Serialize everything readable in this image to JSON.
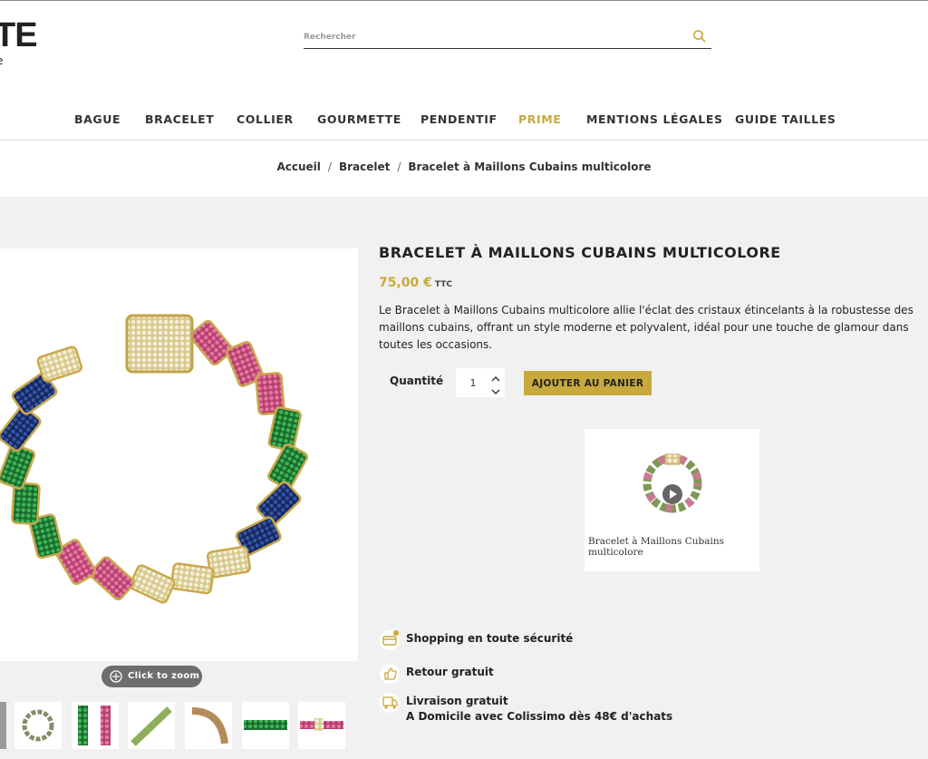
{
  "header": {
    "logo_text": "TE",
    "logo_sub": "e",
    "search_placeholder": "Rechercher"
  },
  "nav": {
    "items": [
      "BAGUE",
      "BRACELET",
      "COLLIER",
      "GOURMETTE",
      "PENDENTIF",
      "PRIME",
      "MENTIONS LÉGALES",
      "GUIDE TAILLES"
    ],
    "active_accent": "PRIME"
  },
  "breadcrumb": [
    "Accueil",
    "Bracelet",
    "Bracelet à Maillons Cubains multicolore"
  ],
  "product": {
    "title": "BRACELET À MAILLONS CUBAINS MULTICOLORE",
    "price": "75,00 €",
    "price_suffix": "TTC",
    "description_lines": [
      "Le Bracelet à Maillons Cubains multicolore allie l'éclat des cristaux étincelants à la robustesse des",
      "maillons cubains, offrant un style moderne et polyvalent, idéal pour une touche de glamour dans",
      "toutes les occasions."
    ],
    "quantity_label": "Quantité",
    "quantity_value": "1",
    "add_to_cart_label": "AJOUTER AU PANIER",
    "zoom_label": "Click to zoom",
    "video_title": "Bracelet à Maillons Cubains multicolore"
  },
  "reassurance": [
    {
      "icon": "credit-card-icon",
      "text": "Shopping en toute sécurité"
    },
    {
      "icon": "thumbs-up-icon",
      "text": "Retour gratuit"
    },
    {
      "icon": "truck-icon",
      "text": "Livraison gratuit\nA Domicile avec Colissimo dès 48€ d'achats"
    }
  ],
  "colors": {
    "accent": "#c8a93d",
    "background_main": "#f1f1f1",
    "text": "#222222"
  }
}
